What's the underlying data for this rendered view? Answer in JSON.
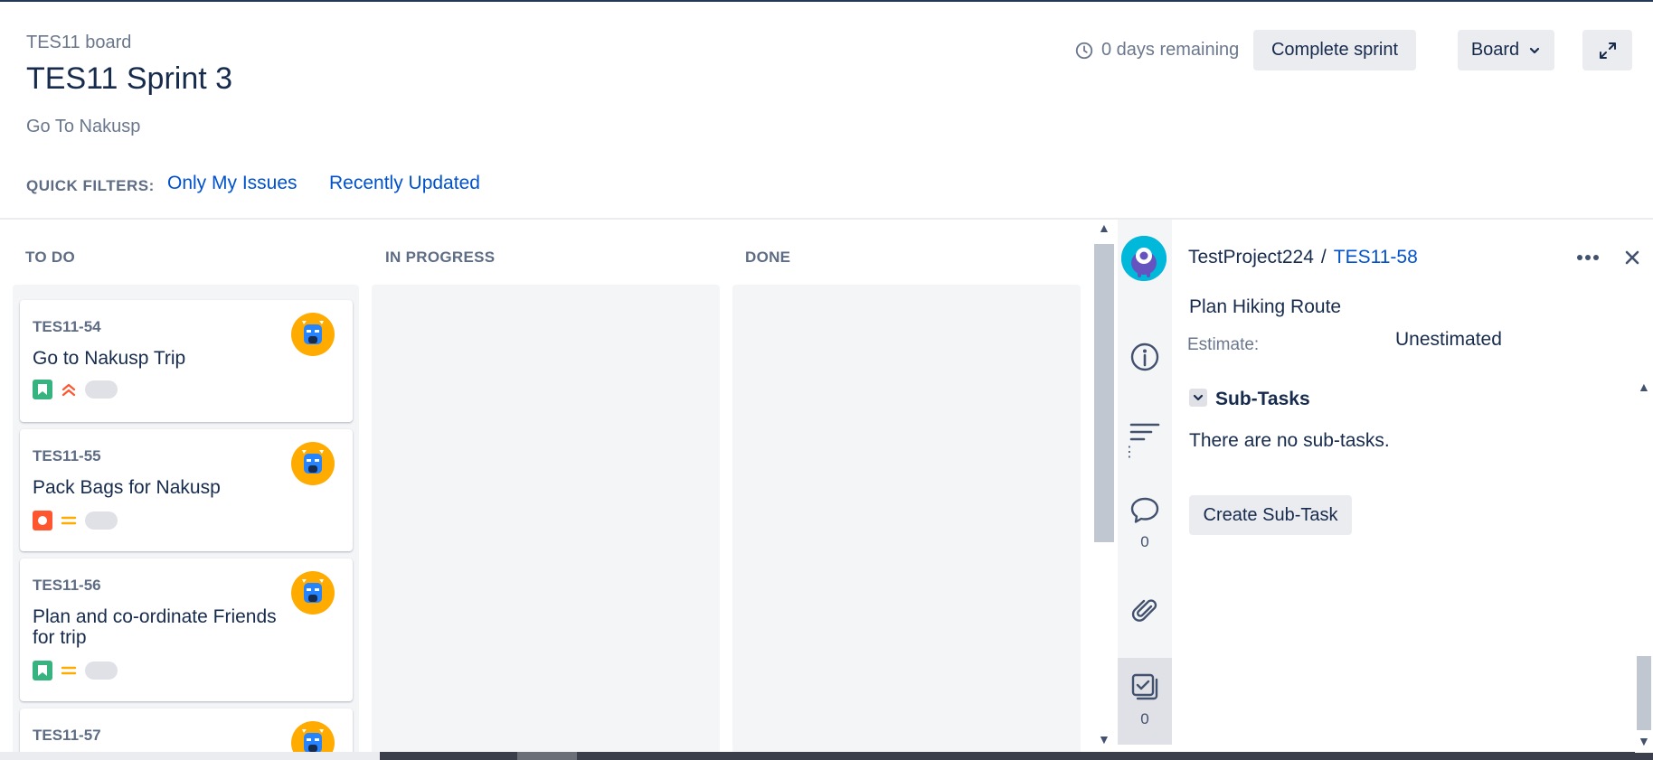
{
  "header": {
    "board_name": "TES11 board",
    "sprint_title": "TES11 Sprint 3",
    "sprint_goal": "Go To Nakusp",
    "days_remaining": "0 days remaining",
    "complete_sprint": "Complete sprint",
    "board_menu": "Board"
  },
  "quick_filters": {
    "label": "QUICK FILTERS:",
    "items": [
      "Only My Issues",
      "Recently Updated"
    ]
  },
  "columns": [
    {
      "title": "TO DO"
    },
    {
      "title": "IN PROGRESS"
    },
    {
      "title": "DONE"
    }
  ],
  "cards": [
    {
      "key": "TES11-54",
      "summary": "Go to Nakusp Trip",
      "type": "story",
      "priority": "highest"
    },
    {
      "key": "TES11-55",
      "summary": "Pack Bags for Nakusp",
      "type": "bug",
      "priority": "medium"
    },
    {
      "key": "TES11-56",
      "summary": "Plan and co-ordinate Friends for trip",
      "type": "story",
      "priority": "medium"
    },
    {
      "key": "TES11-57",
      "summary": "",
      "type": "story",
      "priority": "medium"
    }
  ],
  "detail": {
    "project": "TestProject224",
    "separator": "/",
    "issue_key": "TES11-58",
    "summary": "Plan Hiking Route",
    "estimate_label": "Estimate:",
    "estimate_value": "Unestimated",
    "subtasks_heading": "Sub-Tasks",
    "subtasks_empty": "There are no sub-tasks.",
    "create_subtask": "Create Sub-Task",
    "comments_count": "0",
    "subtasks_count": "0"
  },
  "colors": {
    "accent": "#0052cc",
    "text": "#172b4d",
    "subtle": "#6b778c",
    "column_bg": "#f4f5f7",
    "avatar": "#ffab00",
    "story": "#36b37e",
    "bug": "#ff5630",
    "priority_high": "#ff5630",
    "priority_medium": "#ffab00"
  }
}
